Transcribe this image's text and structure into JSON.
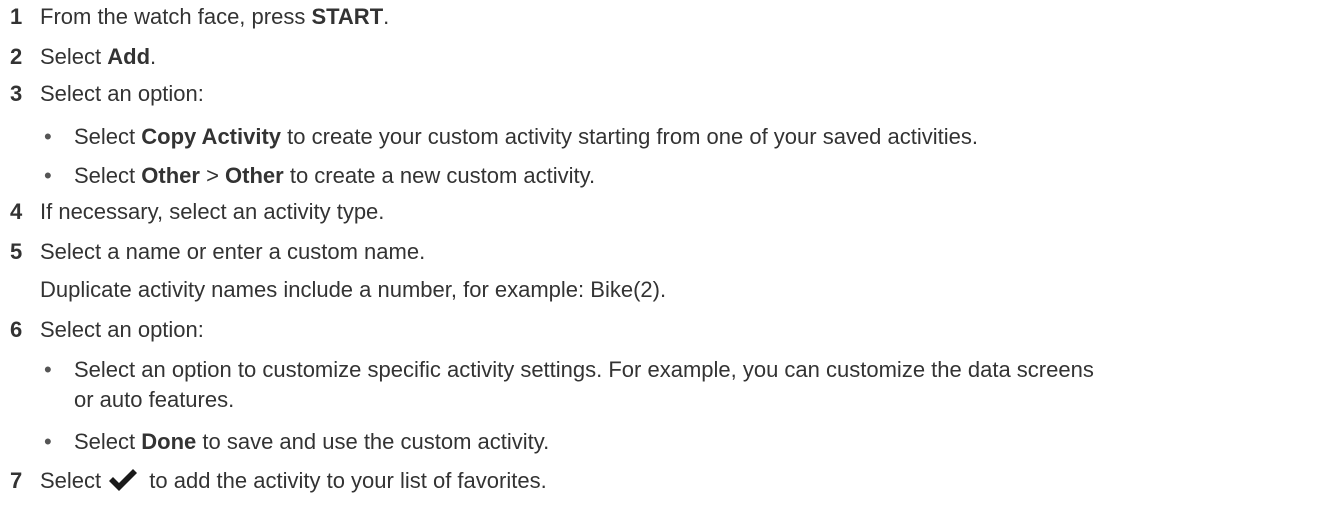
{
  "steps": [
    {
      "number": "1",
      "pre": "From the watch face, press ",
      "bold": "START",
      "post": "."
    },
    {
      "number": "2",
      "pre": "Select ",
      "bold": "Add",
      "post": "."
    },
    {
      "number": "3",
      "text": "Select an option:",
      "bullets": [
        {
          "pre": "Select ",
          "bold": "Copy Activity",
          "post": " to create your custom activity starting from one of your saved activities."
        },
        {
          "pre": "Select ",
          "bold1": "Other",
          "mid": " > ",
          "bold2": "Other",
          "post": " to create a new custom activity."
        }
      ]
    },
    {
      "number": "4",
      "text": "If necessary, select an activity type."
    },
    {
      "number": "5",
      "text": "Select a name or enter a custom name.",
      "note": "Duplicate activity names include a number, for example: Bike(2)."
    },
    {
      "number": "6",
      "text": "Select an option:",
      "bullets": [
        {
          "line1": "Select an option to customize specific activity settings. For example, you can customize the data screens",
          "line2": "or auto features."
        },
        {
          "pre": "Select ",
          "bold": "Done",
          "post": " to save and use the custom activity."
        }
      ]
    },
    {
      "number": "7",
      "pre": "Select",
      "icon": "checkmark-icon",
      "post": " to add the activity to your list of favorites."
    }
  ],
  "bullet_glyph": "•"
}
